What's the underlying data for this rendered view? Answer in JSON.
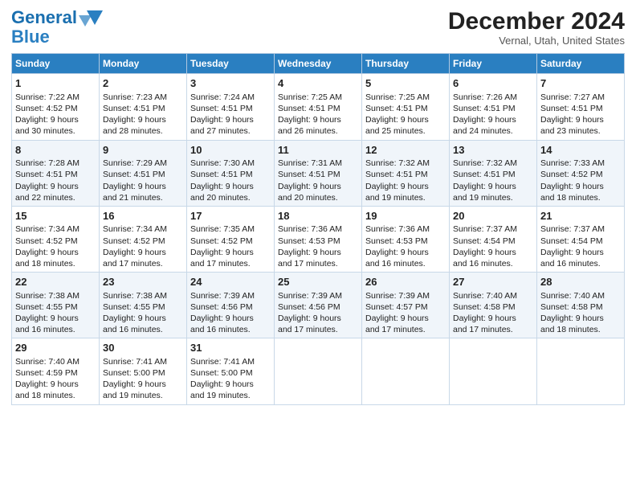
{
  "header": {
    "logo_line1": "General",
    "logo_line2": "Blue",
    "month": "December 2024",
    "location": "Vernal, Utah, United States"
  },
  "weekdays": [
    "Sunday",
    "Monday",
    "Tuesday",
    "Wednesday",
    "Thursday",
    "Friday",
    "Saturday"
  ],
  "weeks": [
    [
      {
        "day": "1",
        "lines": [
          "Sunrise: 7:22 AM",
          "Sunset: 4:52 PM",
          "Daylight: 9 hours",
          "and 30 minutes."
        ]
      },
      {
        "day": "2",
        "lines": [
          "Sunrise: 7:23 AM",
          "Sunset: 4:51 PM",
          "Daylight: 9 hours",
          "and 28 minutes."
        ]
      },
      {
        "day": "3",
        "lines": [
          "Sunrise: 7:24 AM",
          "Sunset: 4:51 PM",
          "Daylight: 9 hours",
          "and 27 minutes."
        ]
      },
      {
        "day": "4",
        "lines": [
          "Sunrise: 7:25 AM",
          "Sunset: 4:51 PM",
          "Daylight: 9 hours",
          "and 26 minutes."
        ]
      },
      {
        "day": "5",
        "lines": [
          "Sunrise: 7:25 AM",
          "Sunset: 4:51 PM",
          "Daylight: 9 hours",
          "and 25 minutes."
        ]
      },
      {
        "day": "6",
        "lines": [
          "Sunrise: 7:26 AM",
          "Sunset: 4:51 PM",
          "Daylight: 9 hours",
          "and 24 minutes."
        ]
      },
      {
        "day": "7",
        "lines": [
          "Sunrise: 7:27 AM",
          "Sunset: 4:51 PM",
          "Daylight: 9 hours",
          "and 23 minutes."
        ]
      }
    ],
    [
      {
        "day": "8",
        "lines": [
          "Sunrise: 7:28 AM",
          "Sunset: 4:51 PM",
          "Daylight: 9 hours",
          "and 22 minutes."
        ]
      },
      {
        "day": "9",
        "lines": [
          "Sunrise: 7:29 AM",
          "Sunset: 4:51 PM",
          "Daylight: 9 hours",
          "and 21 minutes."
        ]
      },
      {
        "day": "10",
        "lines": [
          "Sunrise: 7:30 AM",
          "Sunset: 4:51 PM",
          "Daylight: 9 hours",
          "and 20 minutes."
        ]
      },
      {
        "day": "11",
        "lines": [
          "Sunrise: 7:31 AM",
          "Sunset: 4:51 PM",
          "Daylight: 9 hours",
          "and 20 minutes."
        ]
      },
      {
        "day": "12",
        "lines": [
          "Sunrise: 7:32 AM",
          "Sunset: 4:51 PM",
          "Daylight: 9 hours",
          "and 19 minutes."
        ]
      },
      {
        "day": "13",
        "lines": [
          "Sunrise: 7:32 AM",
          "Sunset: 4:51 PM",
          "Daylight: 9 hours",
          "and 19 minutes."
        ]
      },
      {
        "day": "14",
        "lines": [
          "Sunrise: 7:33 AM",
          "Sunset: 4:52 PM",
          "Daylight: 9 hours",
          "and 18 minutes."
        ]
      }
    ],
    [
      {
        "day": "15",
        "lines": [
          "Sunrise: 7:34 AM",
          "Sunset: 4:52 PM",
          "Daylight: 9 hours",
          "and 18 minutes."
        ]
      },
      {
        "day": "16",
        "lines": [
          "Sunrise: 7:34 AM",
          "Sunset: 4:52 PM",
          "Daylight: 9 hours",
          "and 17 minutes."
        ]
      },
      {
        "day": "17",
        "lines": [
          "Sunrise: 7:35 AM",
          "Sunset: 4:52 PM",
          "Daylight: 9 hours",
          "and 17 minutes."
        ]
      },
      {
        "day": "18",
        "lines": [
          "Sunrise: 7:36 AM",
          "Sunset: 4:53 PM",
          "Daylight: 9 hours",
          "and 17 minutes."
        ]
      },
      {
        "day": "19",
        "lines": [
          "Sunrise: 7:36 AM",
          "Sunset: 4:53 PM",
          "Daylight: 9 hours",
          "and 16 minutes."
        ]
      },
      {
        "day": "20",
        "lines": [
          "Sunrise: 7:37 AM",
          "Sunset: 4:54 PM",
          "Daylight: 9 hours",
          "and 16 minutes."
        ]
      },
      {
        "day": "21",
        "lines": [
          "Sunrise: 7:37 AM",
          "Sunset: 4:54 PM",
          "Daylight: 9 hours",
          "and 16 minutes."
        ]
      }
    ],
    [
      {
        "day": "22",
        "lines": [
          "Sunrise: 7:38 AM",
          "Sunset: 4:55 PM",
          "Daylight: 9 hours",
          "and 16 minutes."
        ]
      },
      {
        "day": "23",
        "lines": [
          "Sunrise: 7:38 AM",
          "Sunset: 4:55 PM",
          "Daylight: 9 hours",
          "and 16 minutes."
        ]
      },
      {
        "day": "24",
        "lines": [
          "Sunrise: 7:39 AM",
          "Sunset: 4:56 PM",
          "Daylight: 9 hours",
          "and 16 minutes."
        ]
      },
      {
        "day": "25",
        "lines": [
          "Sunrise: 7:39 AM",
          "Sunset: 4:56 PM",
          "Daylight: 9 hours",
          "and 17 minutes."
        ]
      },
      {
        "day": "26",
        "lines": [
          "Sunrise: 7:39 AM",
          "Sunset: 4:57 PM",
          "Daylight: 9 hours",
          "and 17 minutes."
        ]
      },
      {
        "day": "27",
        "lines": [
          "Sunrise: 7:40 AM",
          "Sunset: 4:58 PM",
          "Daylight: 9 hours",
          "and 17 minutes."
        ]
      },
      {
        "day": "28",
        "lines": [
          "Sunrise: 7:40 AM",
          "Sunset: 4:58 PM",
          "Daylight: 9 hours",
          "and 18 minutes."
        ]
      }
    ],
    [
      {
        "day": "29",
        "lines": [
          "Sunrise: 7:40 AM",
          "Sunset: 4:59 PM",
          "Daylight: 9 hours",
          "and 18 minutes."
        ]
      },
      {
        "day": "30",
        "lines": [
          "Sunrise: 7:41 AM",
          "Sunset: 5:00 PM",
          "Daylight: 9 hours",
          "and 19 minutes."
        ]
      },
      {
        "day": "31",
        "lines": [
          "Sunrise: 7:41 AM",
          "Sunset: 5:00 PM",
          "Daylight: 9 hours",
          "and 19 minutes."
        ]
      },
      {
        "day": "",
        "lines": []
      },
      {
        "day": "",
        "lines": []
      },
      {
        "day": "",
        "lines": []
      },
      {
        "day": "",
        "lines": []
      }
    ]
  ]
}
